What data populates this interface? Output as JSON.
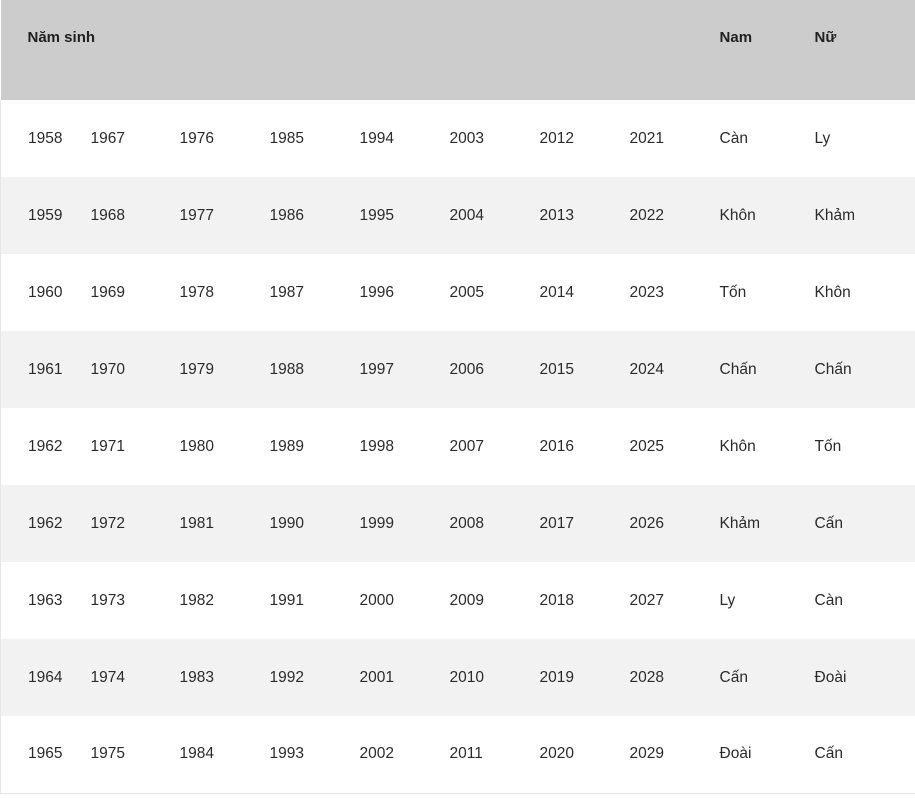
{
  "table": {
    "headers": {
      "birth_year": "Năm sinh",
      "male": "Nam",
      "female": "Nữ"
    },
    "rows": [
      {
        "years": [
          "1958",
          "1967",
          "1976",
          "1985",
          "1994",
          "2003",
          "2012",
          "2021"
        ],
        "nam": "Càn",
        "nu": "Ly"
      },
      {
        "years": [
          "1959",
          "1968",
          "1977",
          "1986",
          "1995",
          "2004",
          "2013",
          "2022"
        ],
        "nam": "Khôn",
        "nu": "Khảm"
      },
      {
        "years": [
          "1960",
          "1969",
          "1978",
          "1987",
          "1996",
          "2005",
          "2014",
          "2023"
        ],
        "nam": "Tốn",
        "nu": "Khôn"
      },
      {
        "years": [
          "1961",
          "1970",
          "1979",
          "1988",
          "1997",
          "2006",
          "2015",
          "2024"
        ],
        "nam": "Chấn",
        "nu": "Chấn"
      },
      {
        "years": [
          "1962",
          "1971",
          "1980",
          "1989",
          "1998",
          "2007",
          "2016",
          "2025"
        ],
        "nam": "Khôn",
        "nu": "Tốn"
      },
      {
        "years": [
          "1962",
          "1972",
          "1981",
          "1990",
          "1999",
          "2008",
          "2017",
          "2026"
        ],
        "nam": "Khảm",
        "nu": "Cấn"
      },
      {
        "years": [
          "1963",
          "1973",
          "1982",
          "1991",
          "2000",
          "2009",
          "2018",
          "2027"
        ],
        "nam": "Ly",
        "nu": "Càn"
      },
      {
        "years": [
          "1964",
          "1974",
          "1983",
          "1992",
          "2001",
          "2010",
          "2019",
          "2028"
        ],
        "nam": "Cấn",
        "nu": "Đoài"
      },
      {
        "years": [
          "1965",
          "1975",
          "1984",
          "1993",
          "2002",
          "2011",
          "2020",
          "2029"
        ],
        "nam": "Đoài",
        "nu": "Cấn"
      }
    ]
  },
  "colors": {
    "header_bg": "#cccccc",
    "row_odd_bg": "#ffffff",
    "row_even_bg": "#f2f2f2",
    "border": "#e6e6e6",
    "header_text": "#212121",
    "body_text": "#2b2b2b"
  }
}
